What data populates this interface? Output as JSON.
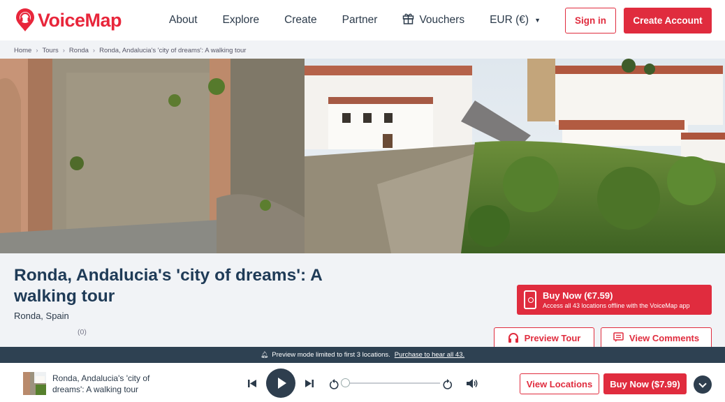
{
  "header": {
    "logo_text": "VoiceMap",
    "nav": {
      "about": "About",
      "explore": "Explore",
      "create": "Create",
      "partner": "Partner",
      "vouchers": "Vouchers",
      "currency": "EUR (€)"
    },
    "sign_in": "Sign in",
    "create_account": "Create Account"
  },
  "breadcrumb": {
    "home": "Home",
    "tours": "Tours",
    "city": "Ronda",
    "current": "Ronda, Andalucia's 'city of dreams': A walking tour"
  },
  "tour": {
    "title": "Ronda, Andalucia's 'city of dreams': A walking tour",
    "location": "Ronda, Spain",
    "rating_count": "(0)"
  },
  "buy_box": {
    "title": "Buy Now (€7.59)",
    "subtitle": "Access all 43 locations offline with the VoiceMap app"
  },
  "actions": {
    "preview": "Preview Tour",
    "comments": "View Comments"
  },
  "preview_bar": {
    "message": "Preview mode limited to first 3 locations.",
    "link": "Purchase to hear all 43."
  },
  "player": {
    "title": "Ronda, Andalucia's 'city of dreams': A walking tour",
    "progress": 0,
    "view_locations": "View Locations",
    "buy_now": "Buy Now ($7.99)"
  },
  "colors": {
    "brand_red": "#e02c3e",
    "dark_navy": "#2e4152",
    "title_blue": "#1f3b57"
  },
  "icons": [
    "voicemap-logo-icon",
    "gift-icon",
    "caret-down-icon",
    "phone-icon",
    "headphones-icon",
    "comment-icon",
    "bell-icon",
    "skip-back-icon",
    "play-icon",
    "skip-forward-icon",
    "rewind-icon",
    "forward-icon",
    "volume-icon",
    "chevron-down-icon"
  ]
}
